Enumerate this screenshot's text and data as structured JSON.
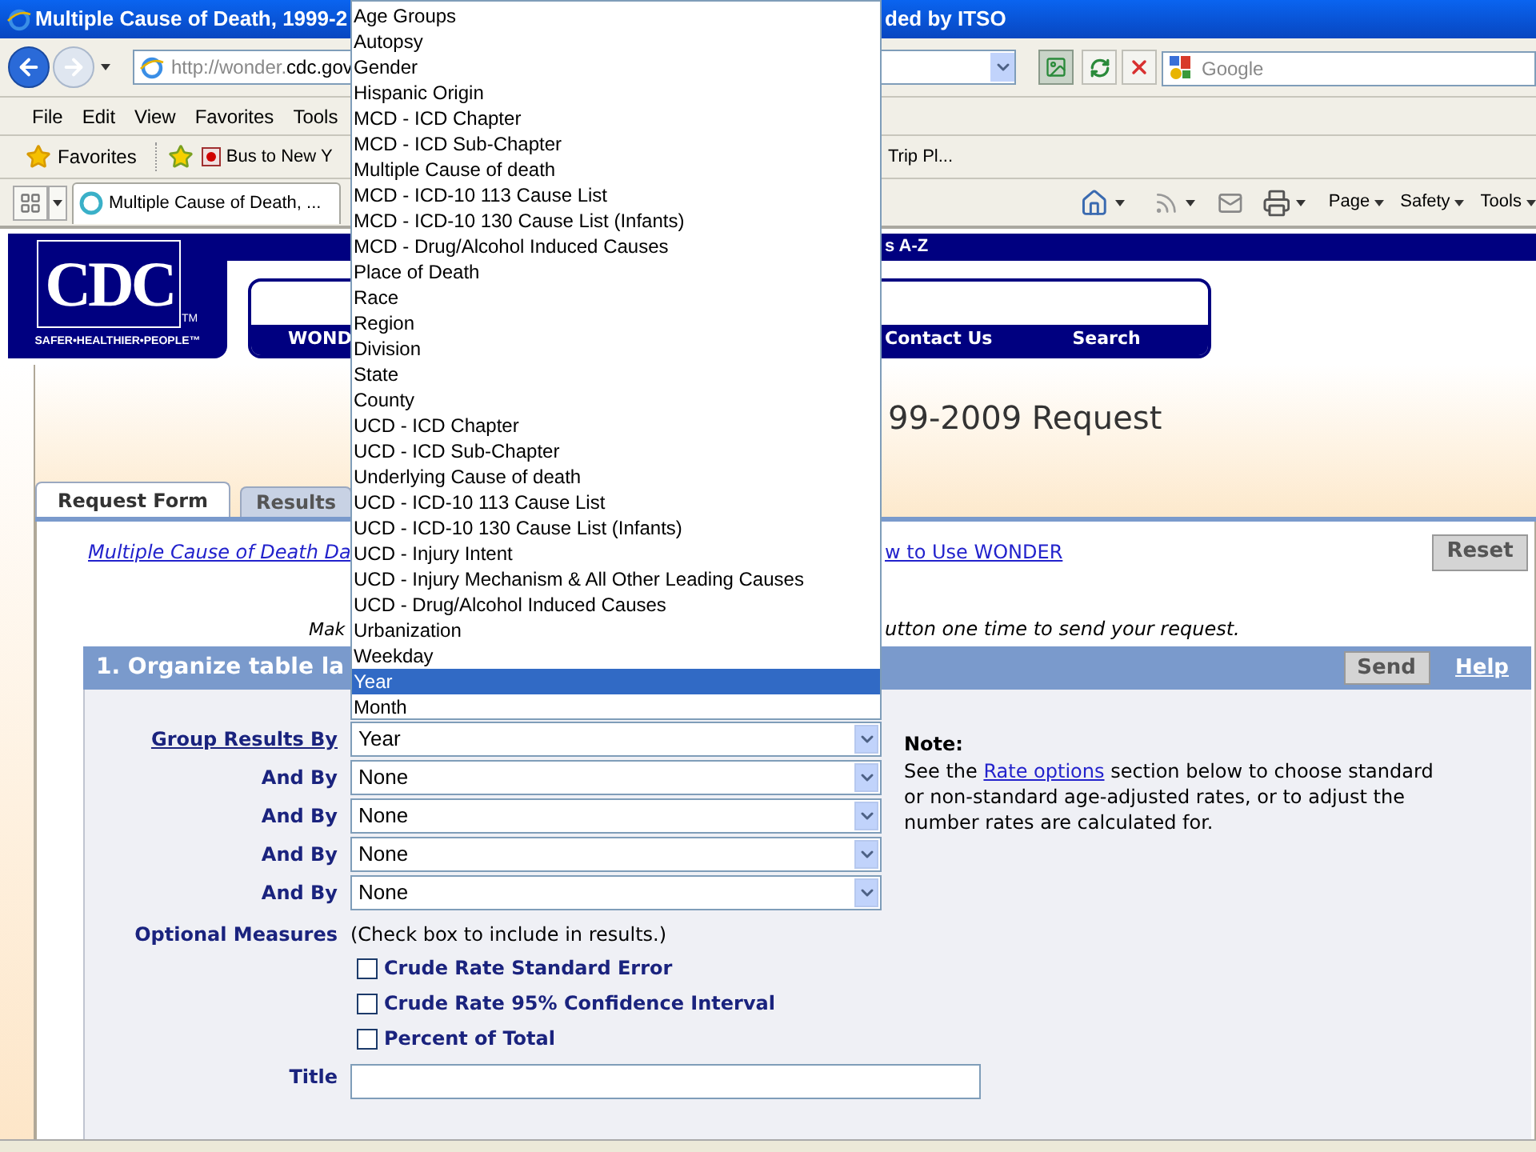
{
  "window": {
    "title_left": "Multiple Cause of Death, 1999-2",
    "title_right": "ded by ITSO"
  },
  "address_bar": {
    "url_prefix": "http://wonder.",
    "url_domain": "cdc.gov"
  },
  "search": {
    "placeholder": "Google"
  },
  "menu": [
    "File",
    "Edit",
    "View",
    "Favorites",
    "Tools"
  ],
  "favorites_bar": {
    "favorites": "Favorites",
    "links": [
      "Bus to New Y",
      "Trip Pl..."
    ]
  },
  "tabs": [
    {
      "label": "Multiple Cause of Death, ...",
      "selected": true
    }
  ],
  "command_bar": [
    "Page",
    "Safety",
    "Tools"
  ],
  "site_header": {
    "logo_text": "CDC",
    "trademark": "TM",
    "tagline": "SAFER•HEALTHIER•PEOPLE™",
    "top_bar_text": "s A-Z",
    "nav": [
      "WOND",
      "Contact Us",
      "Search"
    ]
  },
  "page_title": "99-2009 Request",
  "form_tabs": [
    {
      "label": "Request Form",
      "selected": true
    },
    {
      "label": "Results",
      "selected": false
    }
  ],
  "links": [
    "Multiple Cause of Death Da",
    "w to Use WONDER"
  ],
  "reset_button": "Reset",
  "instruction": [
    "Mak",
    "utton one time to send your request."
  ],
  "section": {
    "title": "1. Organize table la",
    "send_button": "Send",
    "help_link": "Help"
  },
  "group_by": [
    {
      "label": "Group Results By",
      "link": true,
      "value": "Year"
    },
    {
      "label": "And By",
      "link": false,
      "value": "None"
    },
    {
      "label": "And By",
      "link": false,
      "value": "None"
    },
    {
      "label": "And By",
      "link": false,
      "value": "None"
    },
    {
      "label": "And By",
      "link": false,
      "value": "None"
    }
  ],
  "note": {
    "heading": "Note:",
    "before": "See the ",
    "link": "Rate options",
    "after": " section below to choose standard or non-standard age-adjusted rates, or to adjust the number rates are calculated for."
  },
  "optional_measures": {
    "label": "Optional Measures",
    "hint": "(Check box to include in results.)",
    "options": [
      {
        "label": "Crude Rate Standard Error",
        "checked": false
      },
      {
        "label": "Crude Rate 95% Confidence Interval",
        "checked": false
      },
      {
        "label": "Percent of Total",
        "checked": false
      }
    ]
  },
  "title_field": {
    "label": "Title"
  },
  "dropdown": {
    "options": [
      {
        "label": "Age Groups",
        "selected": false
      },
      {
        "label": "Autopsy",
        "selected": false
      },
      {
        "label": "Gender",
        "selected": false
      },
      {
        "label": "Hispanic Origin",
        "selected": false
      },
      {
        "label": "MCD - ICD Chapter",
        "selected": false
      },
      {
        "label": "MCD - ICD Sub-Chapter",
        "selected": false
      },
      {
        "label": "Multiple Cause of death",
        "selected": false
      },
      {
        "label": "MCD - ICD-10 113 Cause List",
        "selected": false
      },
      {
        "label": "MCD - ICD-10 130 Cause List (Infants)",
        "selected": false
      },
      {
        "label": "MCD - Drug/Alcohol Induced Causes",
        "selected": false
      },
      {
        "label": "Place of Death",
        "selected": false
      },
      {
        "label": "Race",
        "selected": false
      },
      {
        "label": "Region",
        "selected": false
      },
      {
        "label": "Division",
        "selected": false
      },
      {
        "label": "State",
        "selected": false
      },
      {
        "label": "County",
        "selected": false
      },
      {
        "label": "UCD - ICD Chapter",
        "selected": false
      },
      {
        "label": "UCD - ICD Sub-Chapter",
        "selected": false
      },
      {
        "label": "Underlying Cause of death",
        "selected": false
      },
      {
        "label": "UCD - ICD-10 113 Cause List",
        "selected": false
      },
      {
        "label": "UCD - ICD-10 130 Cause List (Infants)",
        "selected": false
      },
      {
        "label": "UCD - Injury Intent",
        "selected": false
      },
      {
        "label": "UCD - Injury Mechanism & All Other Leading Causes",
        "selected": false
      },
      {
        "label": "UCD - Drug/Alcohol Induced Causes",
        "selected": false
      },
      {
        "label": "Urbanization",
        "selected": false
      },
      {
        "label": "Weekday",
        "selected": false
      },
      {
        "label": "Year",
        "selected": true
      },
      {
        "label": "Month",
        "selected": false
      }
    ]
  }
}
